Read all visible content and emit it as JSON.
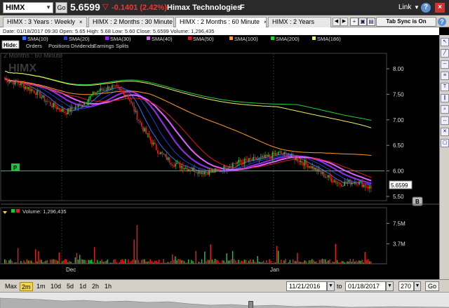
{
  "topbar": {
    "symbol": "HIMX",
    "go_label": "Go",
    "last_price": "5.6599",
    "change_arrow": "▽",
    "change": "-0.1401 (2.42%)",
    "company": "Himax Technologies",
    "flag": "F",
    "link_label": "Link"
  },
  "tabs": [
    {
      "label": "HIMX : 3 Years : Weekly"
    },
    {
      "label": "HIMX : 2 Months : 30 Minute"
    },
    {
      "label": "HIMX : 2 Months : 60 Minute"
    },
    {
      "label": "HIMX : 2 Years"
    }
  ],
  "tab_sync_label": "Tab Sync is On",
  "info_row": "Date: 01/18/2017 09:30   Open: 5.65   High: 5.68   Low: 5.60   Close: 5.6599   Volume: 1,296,435",
  "hide_label": "Hide:",
  "legend_row1": [
    {
      "label": "SMA(10)",
      "color": "#3a6cff"
    },
    {
      "label": "SMA(20)",
      "color": "#1a3fd0"
    },
    {
      "label": "SMA(30)",
      "color": "#8a2be2"
    },
    {
      "label": "SMA(40)",
      "color": "#e060ff"
    },
    {
      "label": "SMA(50)",
      "color": "#d02020"
    },
    {
      "label": "SMA(100)",
      "color": "#ff9a20"
    },
    {
      "label": "SMA(200)",
      "color": "#20d040"
    },
    {
      "label": "SMA(186)",
      "color": "#f0f060"
    }
  ],
  "legend_row2": [
    "Orders",
    "Positions",
    "Dividends",
    "Earnings",
    "Splits"
  ],
  "watermark_symbol": "HIMX",
  "watermark_period": "2 Months : 60 Minute",
  "price_axis": [
    "8.00",
    "7.50",
    "7.00",
    "6.50",
    "6.00",
    "5.50"
  ],
  "price_marker": "5.6599",
  "b_marker": "B",
  "p_marker": "P",
  "volume_label": "Volume: 1,296,435",
  "volume_axis": [
    "7.5M",
    "3.7M"
  ],
  "x_axis": [
    "Dec",
    "Jan"
  ],
  "periods": [
    {
      "label": "Max",
      "active": false
    },
    {
      "label": "2m",
      "active": true
    },
    {
      "label": "1m",
      "active": false
    },
    {
      "label": "10d",
      "active": false
    },
    {
      "label": "5d",
      "active": false
    },
    {
      "label": "1d",
      "active": false
    },
    {
      "label": "2h",
      "active": false
    },
    {
      "label": "1h",
      "active": false
    }
  ],
  "date_from": "11/21/2016",
  "date_to_label": "to",
  "date_to": "01/18/2017",
  "bars_count": "270",
  "bottom_go": "Go",
  "colors": {
    "up": "#20c040",
    "down": "#e02020",
    "horizontal_line": "#20d040"
  },
  "chart_data": {
    "type": "candlestick",
    "ylim": [
      5.3,
      8.2
    ],
    "price_series_approx": [
      7.8,
      7.7,
      7.55,
      7.3,
      7.15,
      7.3,
      7.55,
      7.65,
      7.5,
      6.85,
      6.4,
      6.15,
      6.05,
      5.98,
      6.0,
      6.15,
      6.2,
      6.25,
      6.35,
      6.25,
      6.1,
      5.9,
      5.75,
      5.8,
      5.66
    ],
    "horizontal_line_price": 6.0
  }
}
